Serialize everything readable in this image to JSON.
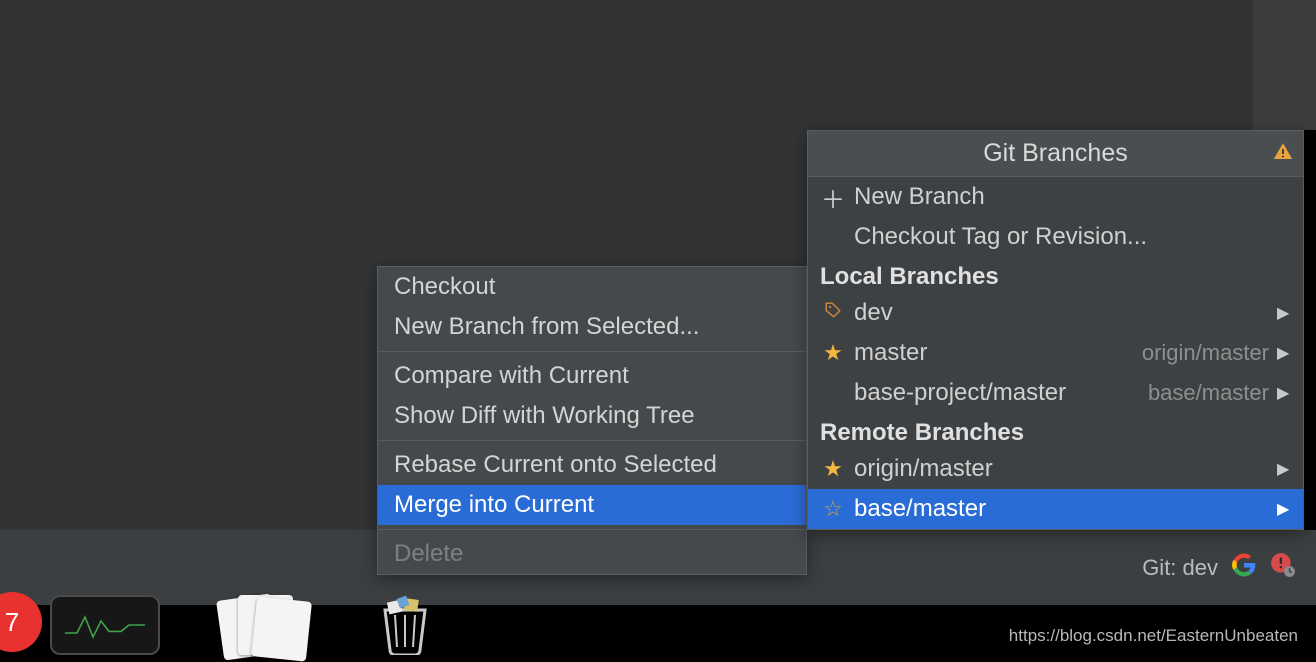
{
  "status_bar": {
    "git_label": "Git: dev"
  },
  "branches_panel": {
    "title": "Git Branches",
    "new_branch": "New Branch",
    "checkout_tag": "Checkout Tag or Revision...",
    "local_header": "Local Branches",
    "local": [
      {
        "name": "dev",
        "icon": "tag",
        "trail": "",
        "has_sub": true,
        "selected": false
      },
      {
        "name": "master",
        "icon": "star-filled",
        "trail": "origin/master",
        "has_sub": true,
        "selected": false
      },
      {
        "name": "base-project/master",
        "icon": "",
        "trail": "base/master",
        "has_sub": true,
        "selected": false
      }
    ],
    "remote_header": "Remote Branches",
    "remote": [
      {
        "name": "origin/master",
        "icon": "star-filled",
        "trail": "",
        "has_sub": true,
        "selected": false
      },
      {
        "name": "base/master",
        "icon": "star-outline",
        "trail": "",
        "has_sub": true,
        "selected": true
      }
    ]
  },
  "ctx_menu": {
    "items": [
      {
        "label": "Checkout",
        "state": "enabled"
      },
      {
        "label": "New Branch from Selected...",
        "state": "enabled"
      },
      {
        "sep": true
      },
      {
        "label": "Compare with Current",
        "state": "enabled"
      },
      {
        "label": "Show Diff with Working Tree",
        "state": "enabled"
      },
      {
        "sep": true
      },
      {
        "label": "Rebase Current onto Selected",
        "state": "enabled"
      },
      {
        "label": "Merge into Current",
        "state": "selected"
      },
      {
        "sep": true
      },
      {
        "label": "Delete",
        "state": "disabled"
      }
    ]
  },
  "dock": {
    "badge": "7"
  },
  "watermark": "https://blog.csdn.net/EasternUnbeaten"
}
